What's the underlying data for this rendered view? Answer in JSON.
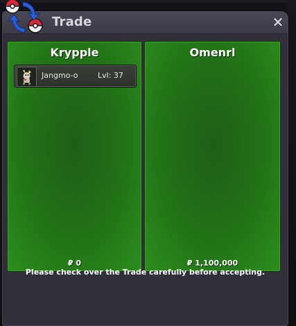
{
  "window": {
    "title": "Trade",
    "close_glyph": "✕",
    "icon": "trade-arrows-icon"
  },
  "left_panel": {
    "player_name": "Krypple",
    "items": [
      {
        "name": "Jangmo-o",
        "level_text": "Lvl: 37",
        "icon": "jangmo-o-sprite-icon"
      }
    ],
    "currency_symbol": "₽",
    "money": "0"
  },
  "right_panel": {
    "player_name": "Omenrl",
    "items": [],
    "currency_symbol": "₽",
    "money": "1,100,000"
  },
  "footer": {
    "notice": "Please check over the Trade carefully before accepting."
  },
  "colors": {
    "window_bg": "#322f3b",
    "title_bar": "#45424f",
    "panel_green": "#227316",
    "panel_border": "#3ea22c",
    "text": "#ffffff",
    "title_text": "#d8d7dd",
    "icon_red": "#d62839",
    "icon_blue": "#2a5fd6"
  }
}
